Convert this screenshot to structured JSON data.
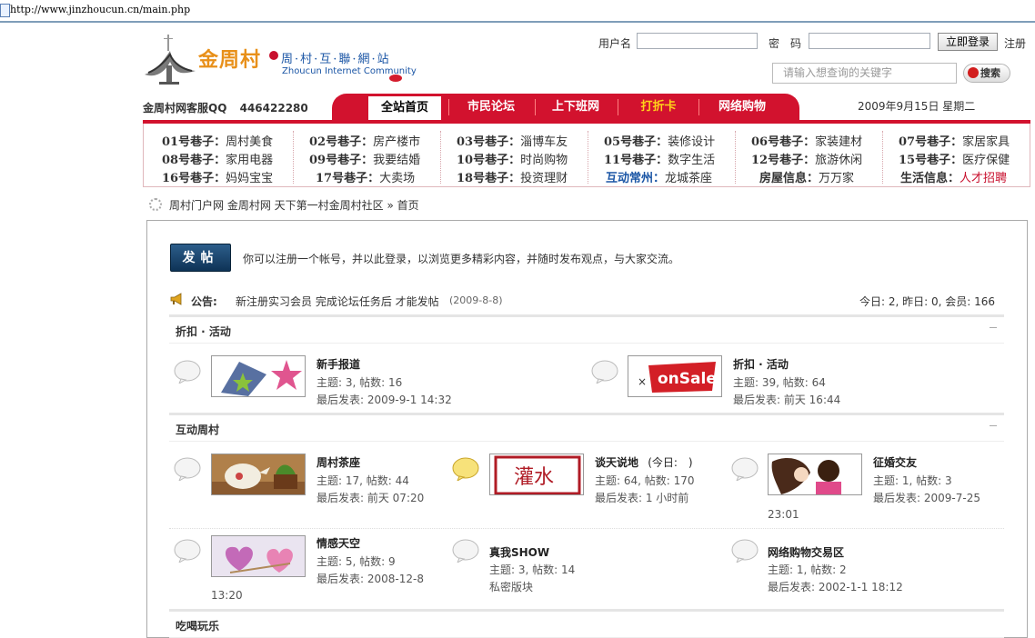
{
  "browser": {
    "url": "http://www.jinzhoucun.cn/main.php"
  },
  "logo": {
    "cn": "金周村",
    "sub": "周·村·互·聯·網·站",
    "en": "Zhoucun Internet Community"
  },
  "login": {
    "username_label": "用户名",
    "password_label": "密　码",
    "login_button": "立即登录",
    "register_link": "注册"
  },
  "search": {
    "placeholder": "请输入想查询的关键字",
    "button": "搜索"
  },
  "service": {
    "label": "金周村网客服QQ",
    "qq": "446422280"
  },
  "nav": {
    "items": [
      "全站首页",
      "市民论坛",
      "上下班网",
      "打折卡",
      "网络购物"
    ]
  },
  "date": "2009年9月15日  星期二",
  "lanes": {
    "col1": [
      [
        "01号巷子：",
        "周村美食"
      ],
      [
        "08号巷子：",
        "家用电器"
      ],
      [
        "16号巷子：",
        "妈妈宝宝"
      ]
    ],
    "col2": [
      [
        "02号巷子：",
        "房产楼市"
      ],
      [
        "09号巷子：",
        "我要结婚"
      ],
      [
        "17号巷子：",
        "大卖场"
      ]
    ],
    "col3": [
      [
        "03号巷子：",
        "淄博车友"
      ],
      [
        "10号巷子：",
        "时尚购物"
      ],
      [
        "18号巷子：",
        "投资理财"
      ]
    ],
    "col4": [
      [
        "05号巷子：",
        "装修设计"
      ],
      [
        "11号巷子：",
        "数字生活"
      ],
      [
        "互动常州：",
        "龙城茶座"
      ]
    ],
    "col5": [
      [
        "06号巷子：",
        "家装建材"
      ],
      [
        "12号巷子：",
        "旅游休闲"
      ],
      [
        "房屋信息：",
        "万万家"
      ]
    ],
    "col6": [
      [
        "07号巷子：",
        "家居家具"
      ],
      [
        "15号巷子：",
        "医疗保健"
      ],
      [
        "生活信息：",
        "人才招聘"
      ]
    ]
  },
  "breadcrumb": {
    "path": "周村门户网 金周村网 天下第一村金周村社区",
    "current": "» 首页"
  },
  "main": {
    "post_button": "发帖",
    "intro": "你可以注册一个帐号，并以此登录，以浏览更多精彩内容，并随时发布观点，与大家交流。",
    "announce_label": "公告:",
    "announce_text": "新注册实习会员 完成论坛任务后 才能发帖",
    "announce_date": "(2009-8-8)",
    "stats": "今日: 2, 昨日: 0, 会员: 166"
  },
  "sections": [
    {
      "title": "折扣 · 活动",
      "forums": [
        {
          "name": "新手报道",
          "topics": "主题: 3, 帖数: 16",
          "last": "最后发表: 2009-9-1 14:32"
        },
        {
          "name": "折扣 · 活动",
          "topics": "主题: 39, 帖数: 64",
          "last": "最后发表: 前天 16:44"
        }
      ]
    },
    {
      "title": "互动周村",
      "forums": [
        {
          "name": "周村茶座",
          "topics": "主题: 17, 帖数: 44",
          "last": "最后发表: 前天 07:20"
        },
        {
          "name": "谈天说地",
          "today": "(今日:　)",
          "topics": "主题: 64, 帖数: 170",
          "last": "最后发表: 1 小时前"
        },
        {
          "name": "征婚交友",
          "topics": "主题: 1, 帖数: 3",
          "last": "最后发表: 2009-7-25",
          "last_wrap": "23:01"
        },
        {
          "name": "情感天空",
          "topics": "主题: 5, 帖数: 9",
          "last": "最后发表: 2008-12-8",
          "last_wrap": "13:20"
        },
        {
          "name": "真我SHOW",
          "topics": "主题: 3, 帖数: 14",
          "last": "私密版块"
        },
        {
          "name": "网络购物交易区",
          "topics": "主题: 1, 帖数: 2",
          "last": "最后发表: 2002-1-1 18:12"
        }
      ]
    },
    {
      "title": "吃喝玩乐"
    }
  ],
  "thumbs": {
    "sale_text": "onSale",
    "water_text": "灌水"
  }
}
